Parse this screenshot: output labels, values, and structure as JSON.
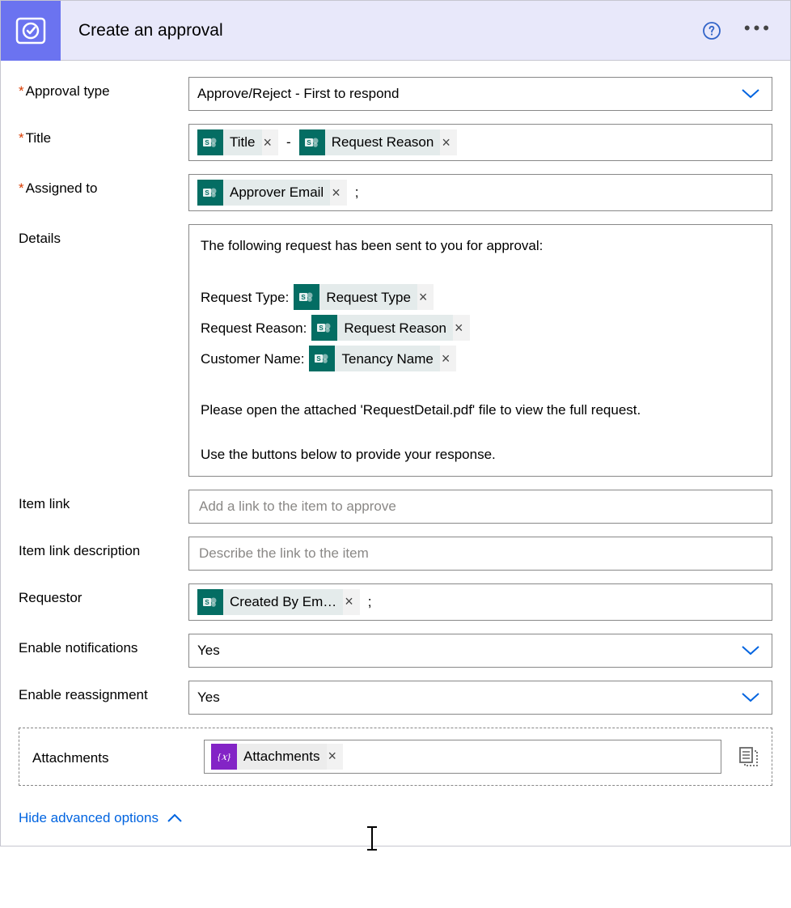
{
  "header": {
    "title": "Create an approval"
  },
  "fields": {
    "approval_type": {
      "label": "Approval type",
      "required": true,
      "value": "Approve/Reject - First to respond"
    },
    "title": {
      "label": "Title",
      "required": true,
      "tokens": [
        {
          "type": "sp",
          "label": "Title"
        },
        {
          "type": "sep",
          "label": "-"
        },
        {
          "type": "sp",
          "label": "Request Reason"
        }
      ]
    },
    "assigned_to": {
      "label": "Assigned to",
      "required": true,
      "tokens": [
        {
          "type": "sp",
          "label": "Approver Email"
        },
        {
          "type": "sep",
          "label": ";"
        }
      ]
    },
    "details": {
      "label": "Details",
      "intro": "The following request has been sent to you for approval:",
      "lines": [
        {
          "prefix": "Request Type:",
          "token": {
            "type": "sp",
            "label": "Request Type"
          }
        },
        {
          "prefix": "Request Reason:",
          "token": {
            "type": "sp",
            "label": "Request Reason"
          }
        },
        {
          "prefix": "Customer Name:",
          "token": {
            "type": "sp",
            "label": "Tenancy Name"
          }
        }
      ],
      "line2": "Please open the attached 'RequestDetail.pdf' file to view the full request.",
      "line3": "Use the buttons below to provide your response."
    },
    "item_link": {
      "label": "Item link",
      "placeholder": "Add a link to the item to approve"
    },
    "item_link_desc": {
      "label": "Item link description",
      "placeholder": "Describe the link to the item"
    },
    "requestor": {
      "label": "Requestor",
      "tokens": [
        {
          "type": "sp",
          "label": "Created By Em…"
        },
        {
          "type": "sep",
          "label": ";"
        }
      ]
    },
    "enable_notifications": {
      "label": "Enable notifications",
      "value": "Yes"
    },
    "enable_reassignment": {
      "label": "Enable reassignment",
      "value": "Yes"
    },
    "attachments": {
      "label": "Attachments",
      "tokens": [
        {
          "type": "var",
          "label": "Attachments"
        }
      ]
    }
  },
  "footer": {
    "link": "Hide advanced options"
  }
}
